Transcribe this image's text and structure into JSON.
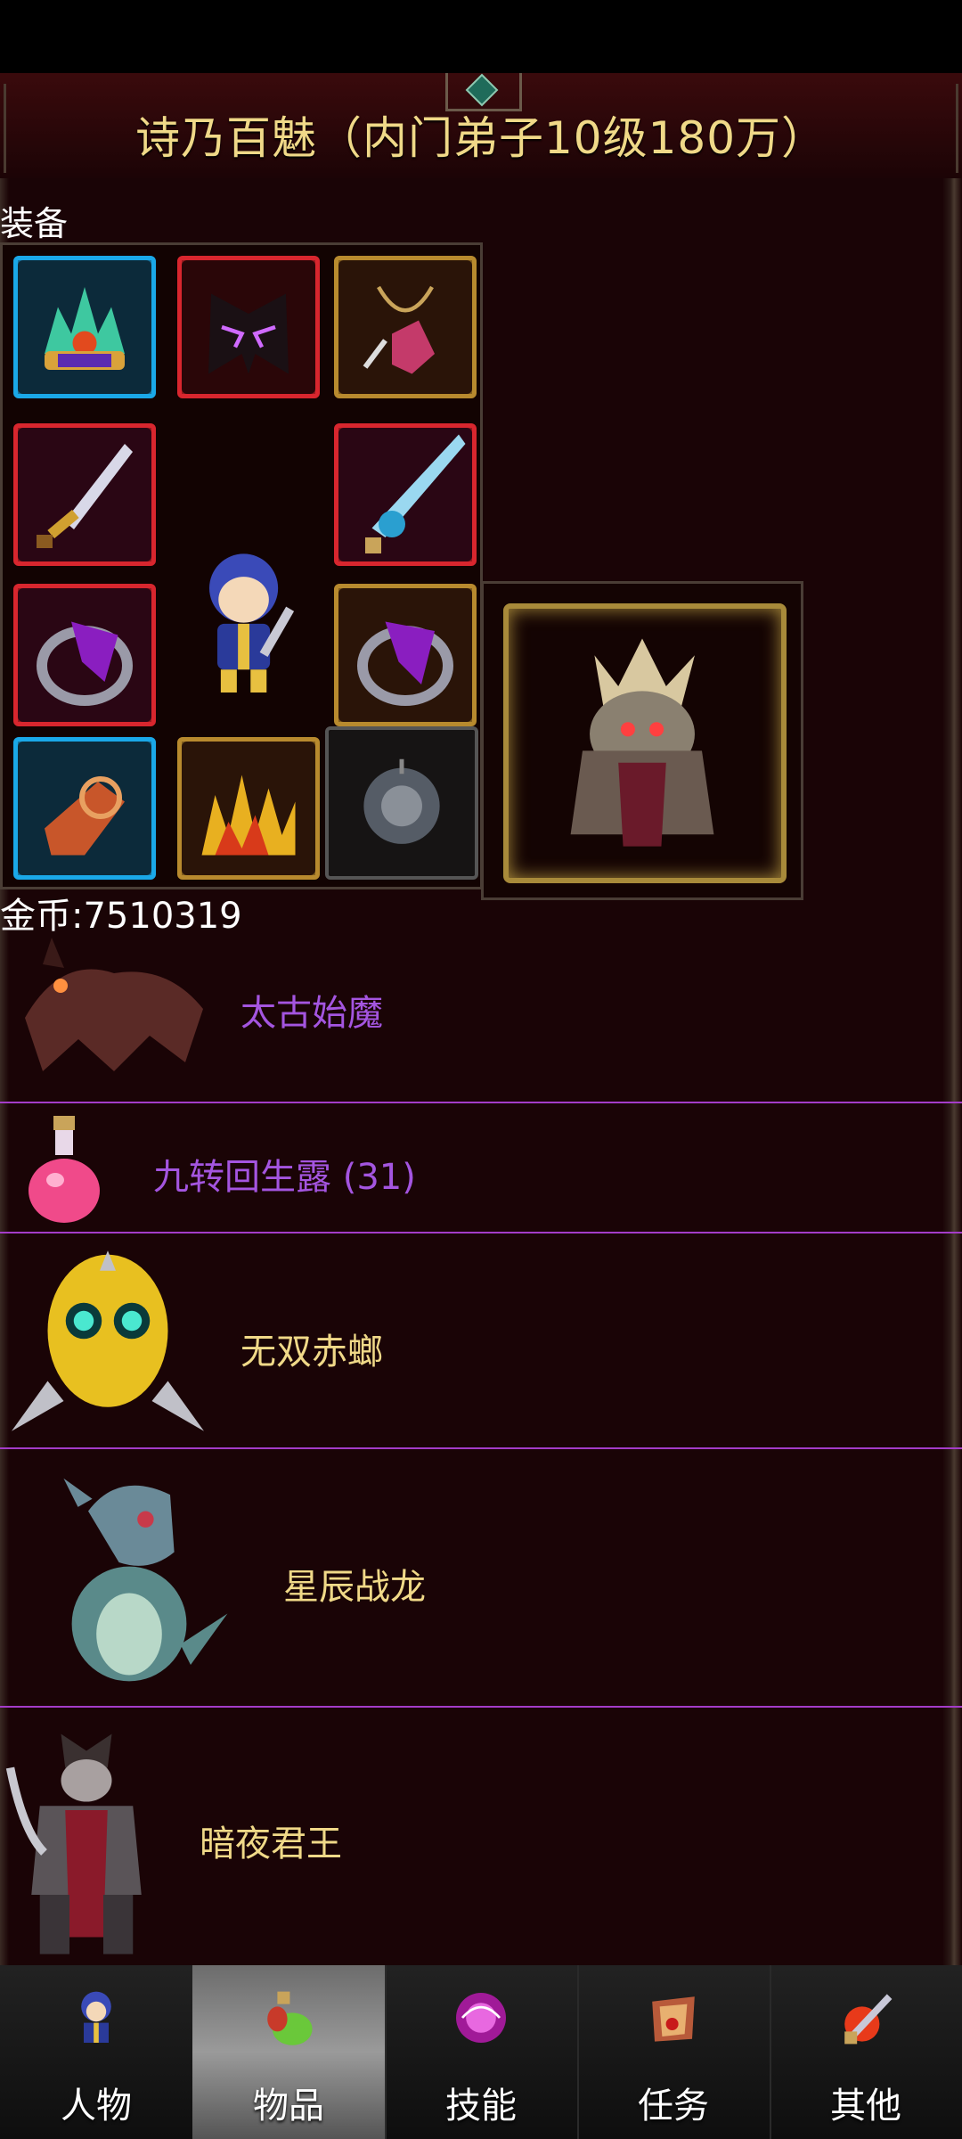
{
  "header": {
    "title": "诗乃百魅（内门弟子10级180万）"
  },
  "equipment": {
    "label": "装备",
    "gold_text": "金币:7510319"
  },
  "items": [
    {
      "name": "太古始魔",
      "color": "#a455e0",
      "icon": "demon-beast-icon"
    },
    {
      "name": "九转回生露 (31)",
      "color": "#a455e0",
      "icon": "potion-flask-icon"
    },
    {
      "name": "无双赤螂",
      "color": "#f0d988",
      "icon": "golden-mantis-icon"
    },
    {
      "name": "星辰战龙",
      "color": "#f0d988",
      "icon": "blue-dragon-icon"
    },
    {
      "name": "暗夜君王",
      "color": "#f0d988",
      "icon": "dark-knight-icon"
    }
  ],
  "tabs": [
    {
      "label": "人物",
      "icon": "character-icon",
      "active": false
    },
    {
      "label": "物品",
      "icon": "items-icon",
      "active": true
    },
    {
      "label": "技能",
      "icon": "skill-icon",
      "active": false
    },
    {
      "label": "任务",
      "icon": "quest-icon",
      "active": false
    },
    {
      "label": "其他",
      "icon": "other-icon",
      "active": false
    }
  ],
  "colors": {
    "title_gold": "#f0d988",
    "purple_item": "#a455e0",
    "separator": "#a43cc8",
    "background": "#1a0406"
  }
}
